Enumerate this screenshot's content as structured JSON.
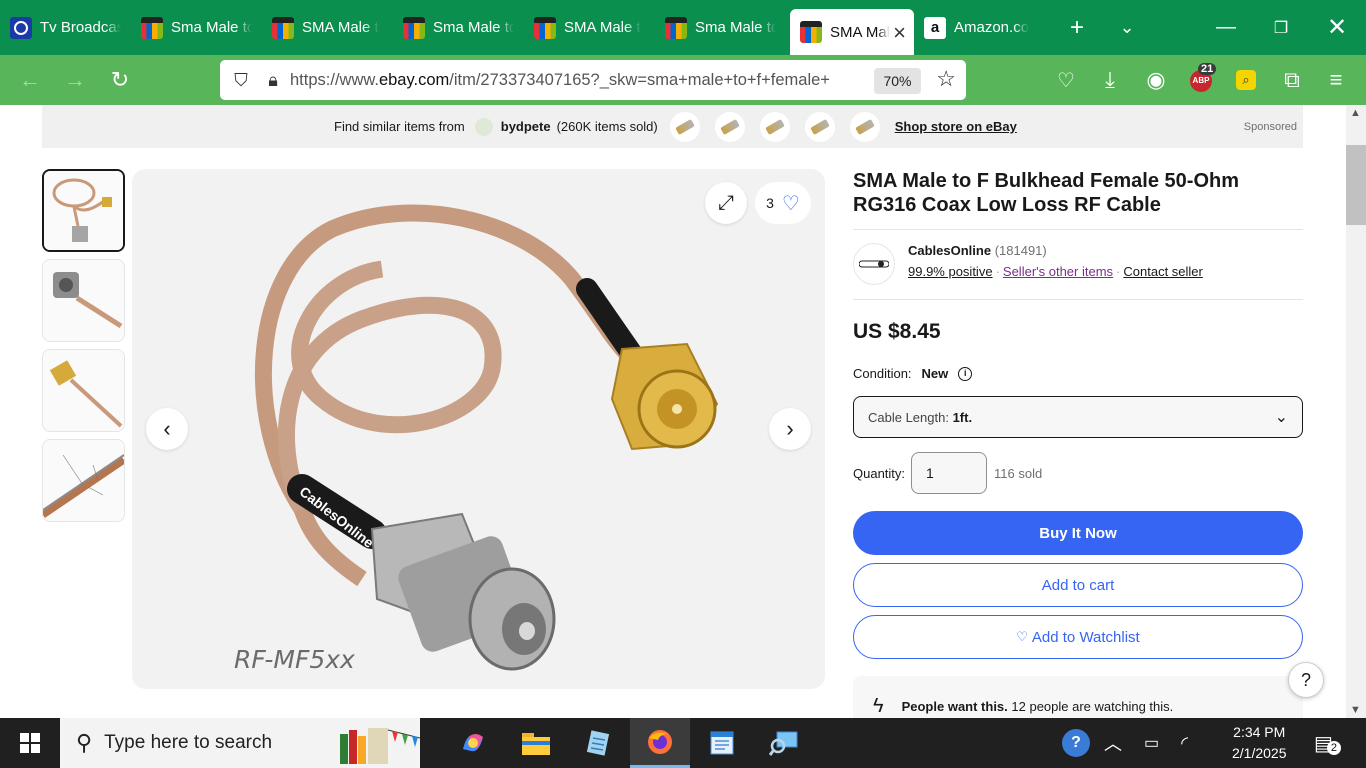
{
  "browser": {
    "tabs": [
      {
        "label": "Tv Broadcas",
        "icon": "tv-broadcast-icon"
      },
      {
        "label": "Sma Male to",
        "icon": "ebay-icon"
      },
      {
        "label": "SMA Male t",
        "icon": "ebay-icon"
      },
      {
        "label": "Sma Male to",
        "icon": "ebay-icon"
      },
      {
        "label": "SMA Male t",
        "icon": "ebay-icon"
      },
      {
        "label": "Sma Male to",
        "icon": "ebay-icon"
      },
      {
        "label": "SMA Mal",
        "icon": "ebay-icon",
        "active": true
      },
      {
        "label": "Amazon.co",
        "icon": "amazon-icon"
      }
    ],
    "url_prefix": "https://www.",
    "url_domain": "ebay.com",
    "url_rest": "/itm/273373407165?_skw=sma+male+to+f+female+",
    "zoom": "70%",
    "adblock_count": "21",
    "adblock_label": "ABP",
    "amazon_fav": "a"
  },
  "promo": {
    "prefix": "Find similar items from",
    "seller": "bydpete",
    "count": "(260K items sold)",
    "shop_link": "Shop store on eBay",
    "sponsored": "Sponsored"
  },
  "gallery": {
    "watch_count": "3",
    "model_text": "RF-MF5xx",
    "brand_on_cable": "CablesOnline"
  },
  "product": {
    "title": "SMA Male to F Bulkhead Female 50-Ohm RG316 Coax Low Loss RF Cable",
    "seller_name": "CablesOnline",
    "seller_feedback": "(181491)",
    "positive": "99.9% positive",
    "other_items": "Seller's other items",
    "contact": "Contact seller",
    "price": "US $8.45",
    "condition_label": "Condition:",
    "condition_value": "New",
    "variation_label": "Cable Length:",
    "variation_value": "1ft.",
    "quantity_label": "Quantity:",
    "quantity_value": "1",
    "sold": "116 sold",
    "buy_now": "Buy It Now",
    "add_to_cart": "Add to cart",
    "add_to_watchlist": "Add to Watchlist",
    "watchers_bold": "People want this.",
    "watchers_rest": " 12 people are watching this.",
    "help": "?"
  },
  "taskbar": {
    "search_placeholder": "Type here to search",
    "time": "2:34 PM",
    "date": "2/1/2025",
    "notifications": "2"
  },
  "colors": {
    "tab_strip": "#0b8f4f",
    "toolbar": "#58b55a",
    "ebay_blue": "#3665f3"
  }
}
